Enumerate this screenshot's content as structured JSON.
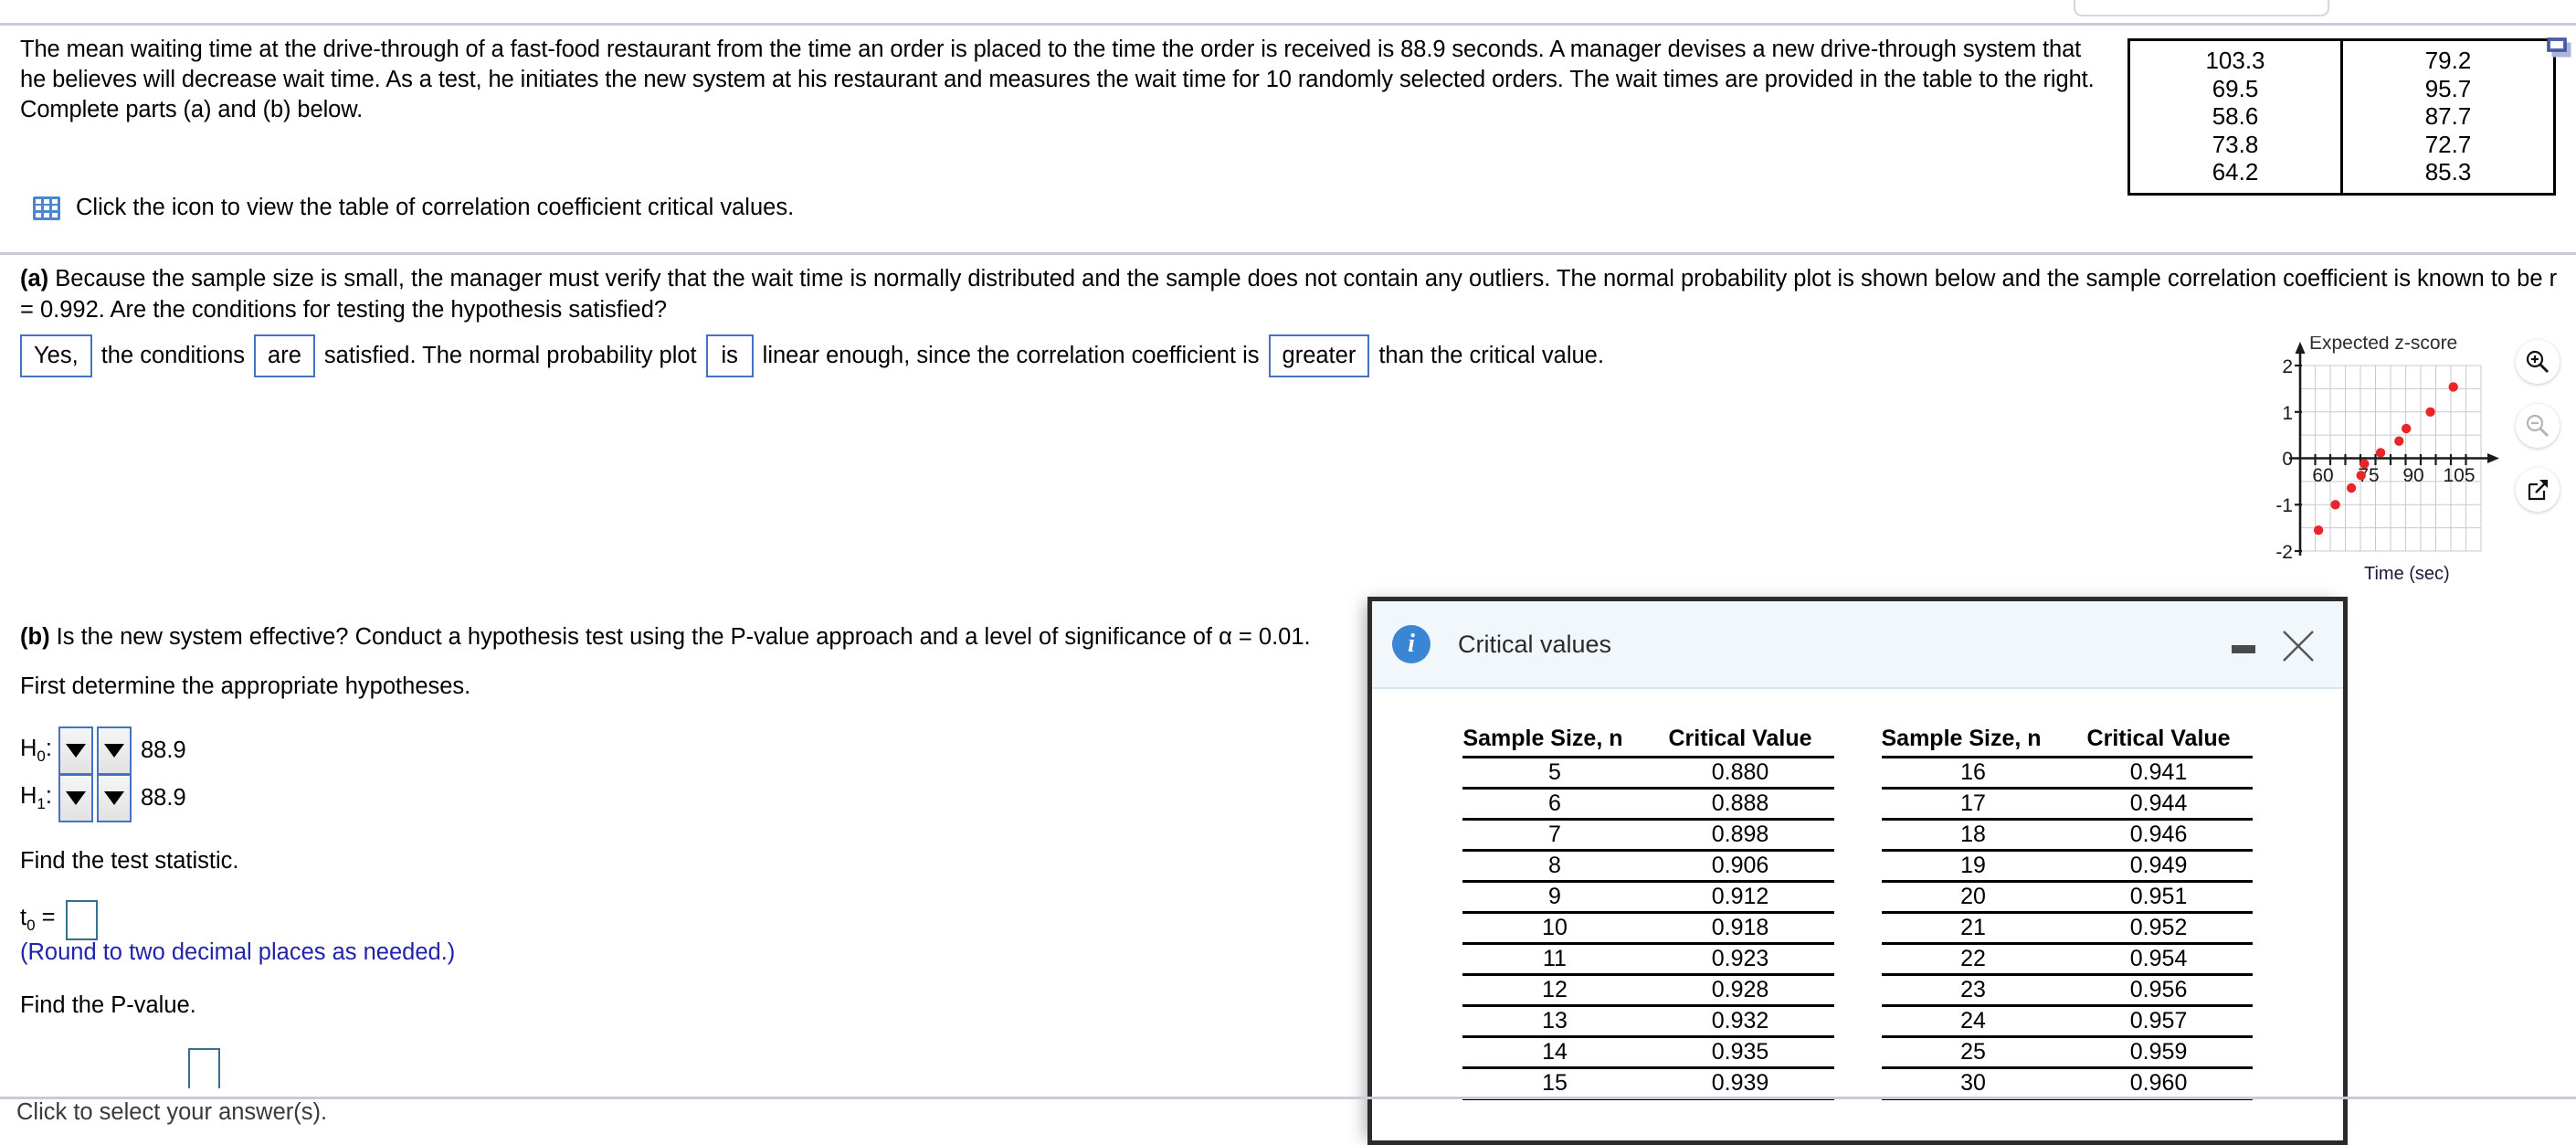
{
  "problem": {
    "statement": "The mean waiting time at the drive-through of a fast-food restaurant from the time an order is placed to the time the order is received is 88.9 seconds. A manager devises a new drive-through system that he believes will decrease wait time. As a test, he initiates the new system at his restaurant and measures the wait time for 10 randomly selected orders. The wait times are provided in the table to the right. Complete parts (a) and (b) below.",
    "icon_link_text": "Click the icon to view the table of correlation coefficient critical values.",
    "data_table": {
      "rows": [
        [
          "103.3",
          "79.2"
        ],
        [
          "69.5",
          "95.7"
        ],
        [
          "58.6",
          "87.7"
        ],
        [
          "73.8",
          "72.7"
        ],
        [
          "64.2",
          "85.3"
        ]
      ]
    }
  },
  "part_a": {
    "label": "(a)",
    "text": " Because the sample size is small, the manager must verify that the wait time is normally distributed and the sample does not contain any outliers. The normal probability plot is shown below and the sample correlation coefficient is known to be r = 0.992. Are the conditions for testing the hypothesis satisfied?",
    "answer": {
      "sel1": "Yes,",
      "frag1": "the conditions",
      "sel2": "are",
      "frag2": "satisfied. The normal probability plot",
      "sel3": "is",
      "frag3": "linear enough, since the correlation coefficient is",
      "sel4": "greater",
      "frag4": "than the critical value."
    }
  },
  "part_b": {
    "label": "(b)",
    "text": " Is the new system effective? Conduct a hypothesis test using the P-value approach and a level of significance of α = 0.01.",
    "first_determine": "First determine the appropriate hypotheses.",
    "h0_label": "H",
    "h0_sub": "0",
    "h0_value": "88.9",
    "h1_label": "H",
    "h1_sub": "1",
    "h1_value": "88.9",
    "dropdown_placeholder": "",
    "find_test_statistic": "Find the test statistic.",
    "t_label": "t",
    "t_sub": "0",
    "t_equals": "=",
    "t_value": "",
    "round_note": "(Round to two decimal places as needed.)",
    "find_pvalue": "Find the P-value.",
    "p_value": ""
  },
  "status_bar": {
    "text": "Click to select your answer(s)."
  },
  "tools": {
    "zoom_in": "zoom-in-icon",
    "zoom_out": "zoom-out-icon",
    "popout": "popout-icon",
    "table_popout": "table-popout-icon"
  },
  "dialog": {
    "title": "Critical values",
    "info_icon": "info-icon",
    "minimize": "minimize-icon",
    "close": "close-icon",
    "left_table": {
      "headers": [
        "Sample Size, n",
        "Critical Value"
      ],
      "rows": [
        [
          "5",
          "0.880"
        ],
        [
          "6",
          "0.888"
        ],
        [
          "7",
          "0.898"
        ],
        [
          "8",
          "0.906"
        ],
        [
          "9",
          "0.912"
        ],
        [
          "10",
          "0.918"
        ],
        [
          "11",
          "0.923"
        ],
        [
          "12",
          "0.928"
        ],
        [
          "13",
          "0.932"
        ],
        [
          "14",
          "0.935"
        ],
        [
          "15",
          "0.939"
        ]
      ]
    },
    "right_table": {
      "headers": [
        "Sample Size, n",
        "Critical Value"
      ],
      "rows": [
        [
          "16",
          "0.941"
        ],
        [
          "17",
          "0.944"
        ],
        [
          "18",
          "0.946"
        ],
        [
          "19",
          "0.949"
        ],
        [
          "20",
          "0.951"
        ],
        [
          "21",
          "0.952"
        ],
        [
          "22",
          "0.954"
        ],
        [
          "23",
          "0.956"
        ],
        [
          "24",
          "0.957"
        ],
        [
          "25",
          "0.959"
        ],
        [
          "30",
          "0.960"
        ]
      ]
    }
  },
  "chart_data": {
    "type": "scatter",
    "title": "",
    "ylabel": "Expected z-score",
    "xlabel": "Time (sec)",
    "xlim": [
      52.5,
      112.5
    ],
    "ylim": [
      -2,
      2
    ],
    "xticks": [
      60,
      75,
      90,
      105
    ],
    "yticks": [
      -2,
      -1,
      0,
      1,
      2
    ],
    "grid": true,
    "legend": "none",
    "point_color": "#e8262a",
    "x": [
      58.6,
      64.2,
      69.5,
      72.7,
      73.8,
      79.2,
      85.3,
      87.7,
      95.7,
      103.3
    ],
    "y": [
      -1.55,
      -1.0,
      -0.64,
      -0.37,
      -0.12,
      0.12,
      0.37,
      0.64,
      1.0,
      1.55
    ]
  }
}
